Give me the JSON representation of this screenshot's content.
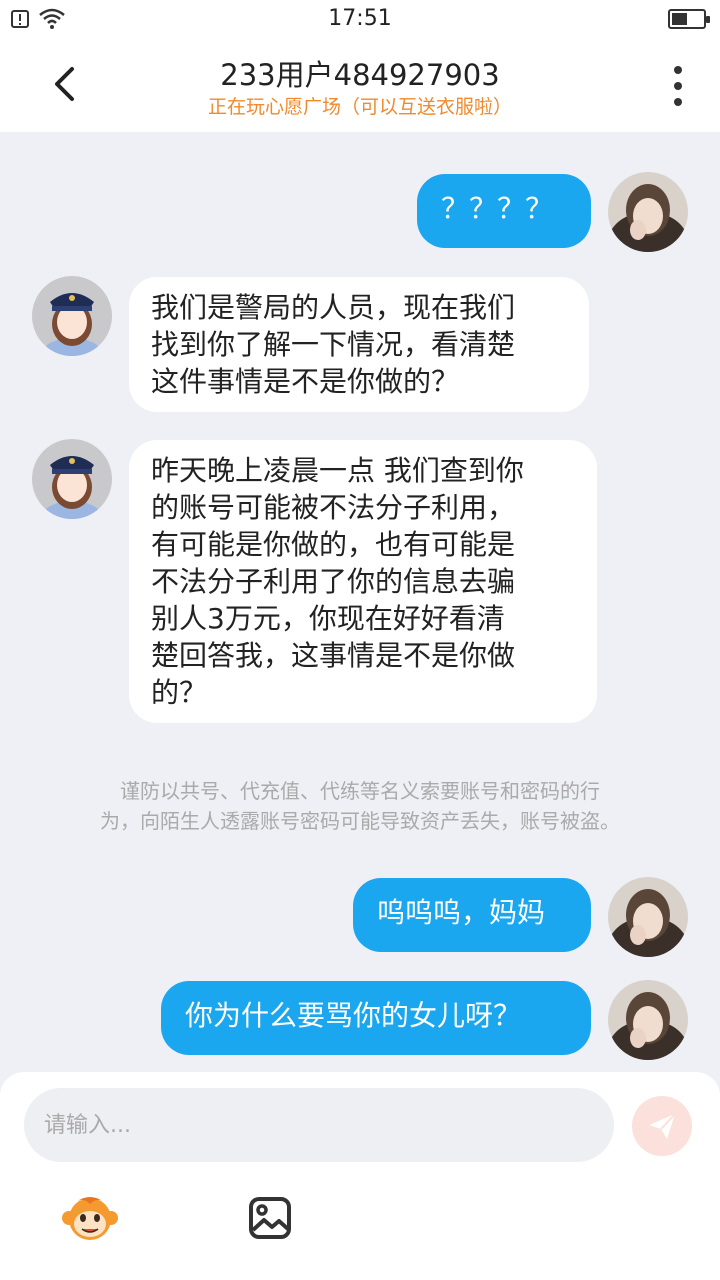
{
  "status_bar": {
    "time": "17:51"
  },
  "header": {
    "title": "233用户484927903",
    "subtitle": "正在玩心愿广场（可以互送衣服啦）"
  },
  "messages": [
    {
      "sender": "me",
      "text": "？？？？"
    },
    {
      "sender": "other",
      "lines": [
        "我们是警局的人员，现在我们",
        "找到你了解一下情况，看清楚",
        "这件事情是不是你做的？"
      ]
    },
    {
      "sender": "other",
      "lines": [
        "昨天晚上凌晨一点 我们查到你",
        "的账号可能被不法分子利用，",
        "有可能是你做的，也有可能是",
        "不法分子利用了你的信息去骗",
        "别人3万元，你现在好好看清",
        "楚回答我，这事情是不是你做",
        "的？"
      ]
    },
    {
      "sender": "me",
      "text": "呜呜呜，妈妈"
    },
    {
      "sender": "me",
      "text": "你为什么要骂你的女儿呀？"
    }
  ],
  "notice": {
    "line1": "谨防以共号、代充值、代练等名义索要账号和密码的行",
    "line2": "为，向陌生人透露账号密码可能导致资产丢失，账号被盗。"
  },
  "input": {
    "placeholder": "请输入..."
  },
  "icons": {
    "back": "chevron-left-icon",
    "more": "more-vertical-icon",
    "send": "send-icon",
    "emoji": "monkey-emoji-icon",
    "image": "image-icon"
  },
  "colors": {
    "accent": "#1aa7f0",
    "subtitle": "#f08a2e",
    "background": "#eef0f5"
  }
}
